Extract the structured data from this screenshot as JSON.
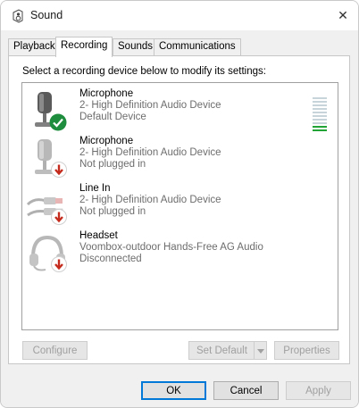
{
  "window": {
    "title": "Sound",
    "close_symbol": "✕"
  },
  "tabs": [
    {
      "label": "Playback",
      "active": false
    },
    {
      "label": "Recording",
      "active": true
    },
    {
      "label": "Sounds",
      "active": false
    },
    {
      "label": "Communications",
      "active": false
    }
  ],
  "instruction": "Select a recording device below to modify its settings:",
  "devices": [
    {
      "name": "Microphone",
      "line1": "2- High Definition Audio Device",
      "line2": "Default Device",
      "icon": "microphone-icon",
      "status_icon": "green-check-icon",
      "level_meter": {
        "bars": 10,
        "active": 2
      }
    },
    {
      "name": "Microphone",
      "line1": "2- High Definition Audio Device",
      "line2": "Not plugged in",
      "icon": "microphone-icon",
      "status_icon": "red-down-arrow-icon"
    },
    {
      "name": "Line In",
      "line1": "2- High Definition Audio Device",
      "line2": "Not plugged in",
      "icon": "line-in-cable-icon",
      "status_icon": "red-down-arrow-icon"
    },
    {
      "name": "Headset",
      "line1": "Voombox-outdoor Hands-Free AG Audio",
      "line2": "Disconnected",
      "icon": "headset-icon",
      "status_icon": "red-down-arrow-icon"
    }
  ],
  "buttons": {
    "configure": "Configure",
    "set_default": "Set Default",
    "properties": "Properties",
    "ok": "OK",
    "cancel": "Cancel",
    "apply": "Apply"
  },
  "colors": {
    "accent": "#0078d7",
    "check_green": "#1e8e3e",
    "unplugged_red": "#c42b1c",
    "level_green": "#21a336"
  }
}
